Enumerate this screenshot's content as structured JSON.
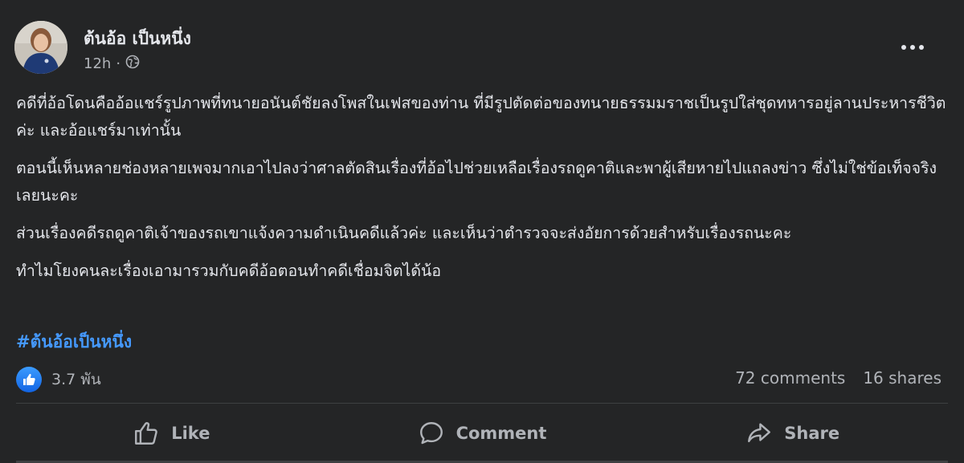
{
  "post": {
    "author": "ต้นอ้อ เป็นหนึ่ง",
    "time": "12h",
    "separator": "·",
    "privacy_icon": "globe-icon",
    "more_icon": "more-horizontal-icon",
    "paragraphs": [
      "คดีที่อ้อโดนคืออ้อแชร์รูปภาพที่ทนายอนันต์ชัยลงโพสในเฟสของท่าน ที่มีรูปตัดต่อของทนายธรรมมราชเป็นรูปใส่ชุดทหารอยู่ลานประหารชีวิตค่ะ และอ้อแชร์มาเท่านั้น",
      "ตอนนี้เห็นหลายช่องหลายเพจมากเอาไปลงว่าศาลตัดสินเรื่องที่อ้อไปช่วยเหลือเรื่องรถดูคาติและพาผู้เสียหายไปแถลงข่าว ซึ่งไม่ใช่ข้อเท็จจริงเลยนะคะ",
      "ส่วนเรื่องคดีรถดูคาติเจ้าของรถเขาแจ้งความดำเนินคดีแล้วค่ะ  และเห็นว่าตำรวจจะส่งอัยการด้วยสำหรับเรื่องรถนะคะ",
      "ทำไมโยงคนละเรื่องเอามารวมกับคดีอ้อตอนทำคดีเชื่อมจิตได้น้อ"
    ],
    "hashtag": "#ต้นอ้อเป็นหนึ่ง"
  },
  "stats": {
    "reaction_icon": "like-icon",
    "reactions": "3.7 พัน",
    "comments": "72 comments",
    "shares": "16 shares"
  },
  "actions": {
    "like": "Like",
    "comment": "Comment",
    "share": "Share"
  },
  "colors": {
    "background": "#242526",
    "text": "#e4e6eb",
    "secondary_text": "#b0b3b8",
    "link": "#4599ff",
    "like_blue": "#1877f2"
  }
}
